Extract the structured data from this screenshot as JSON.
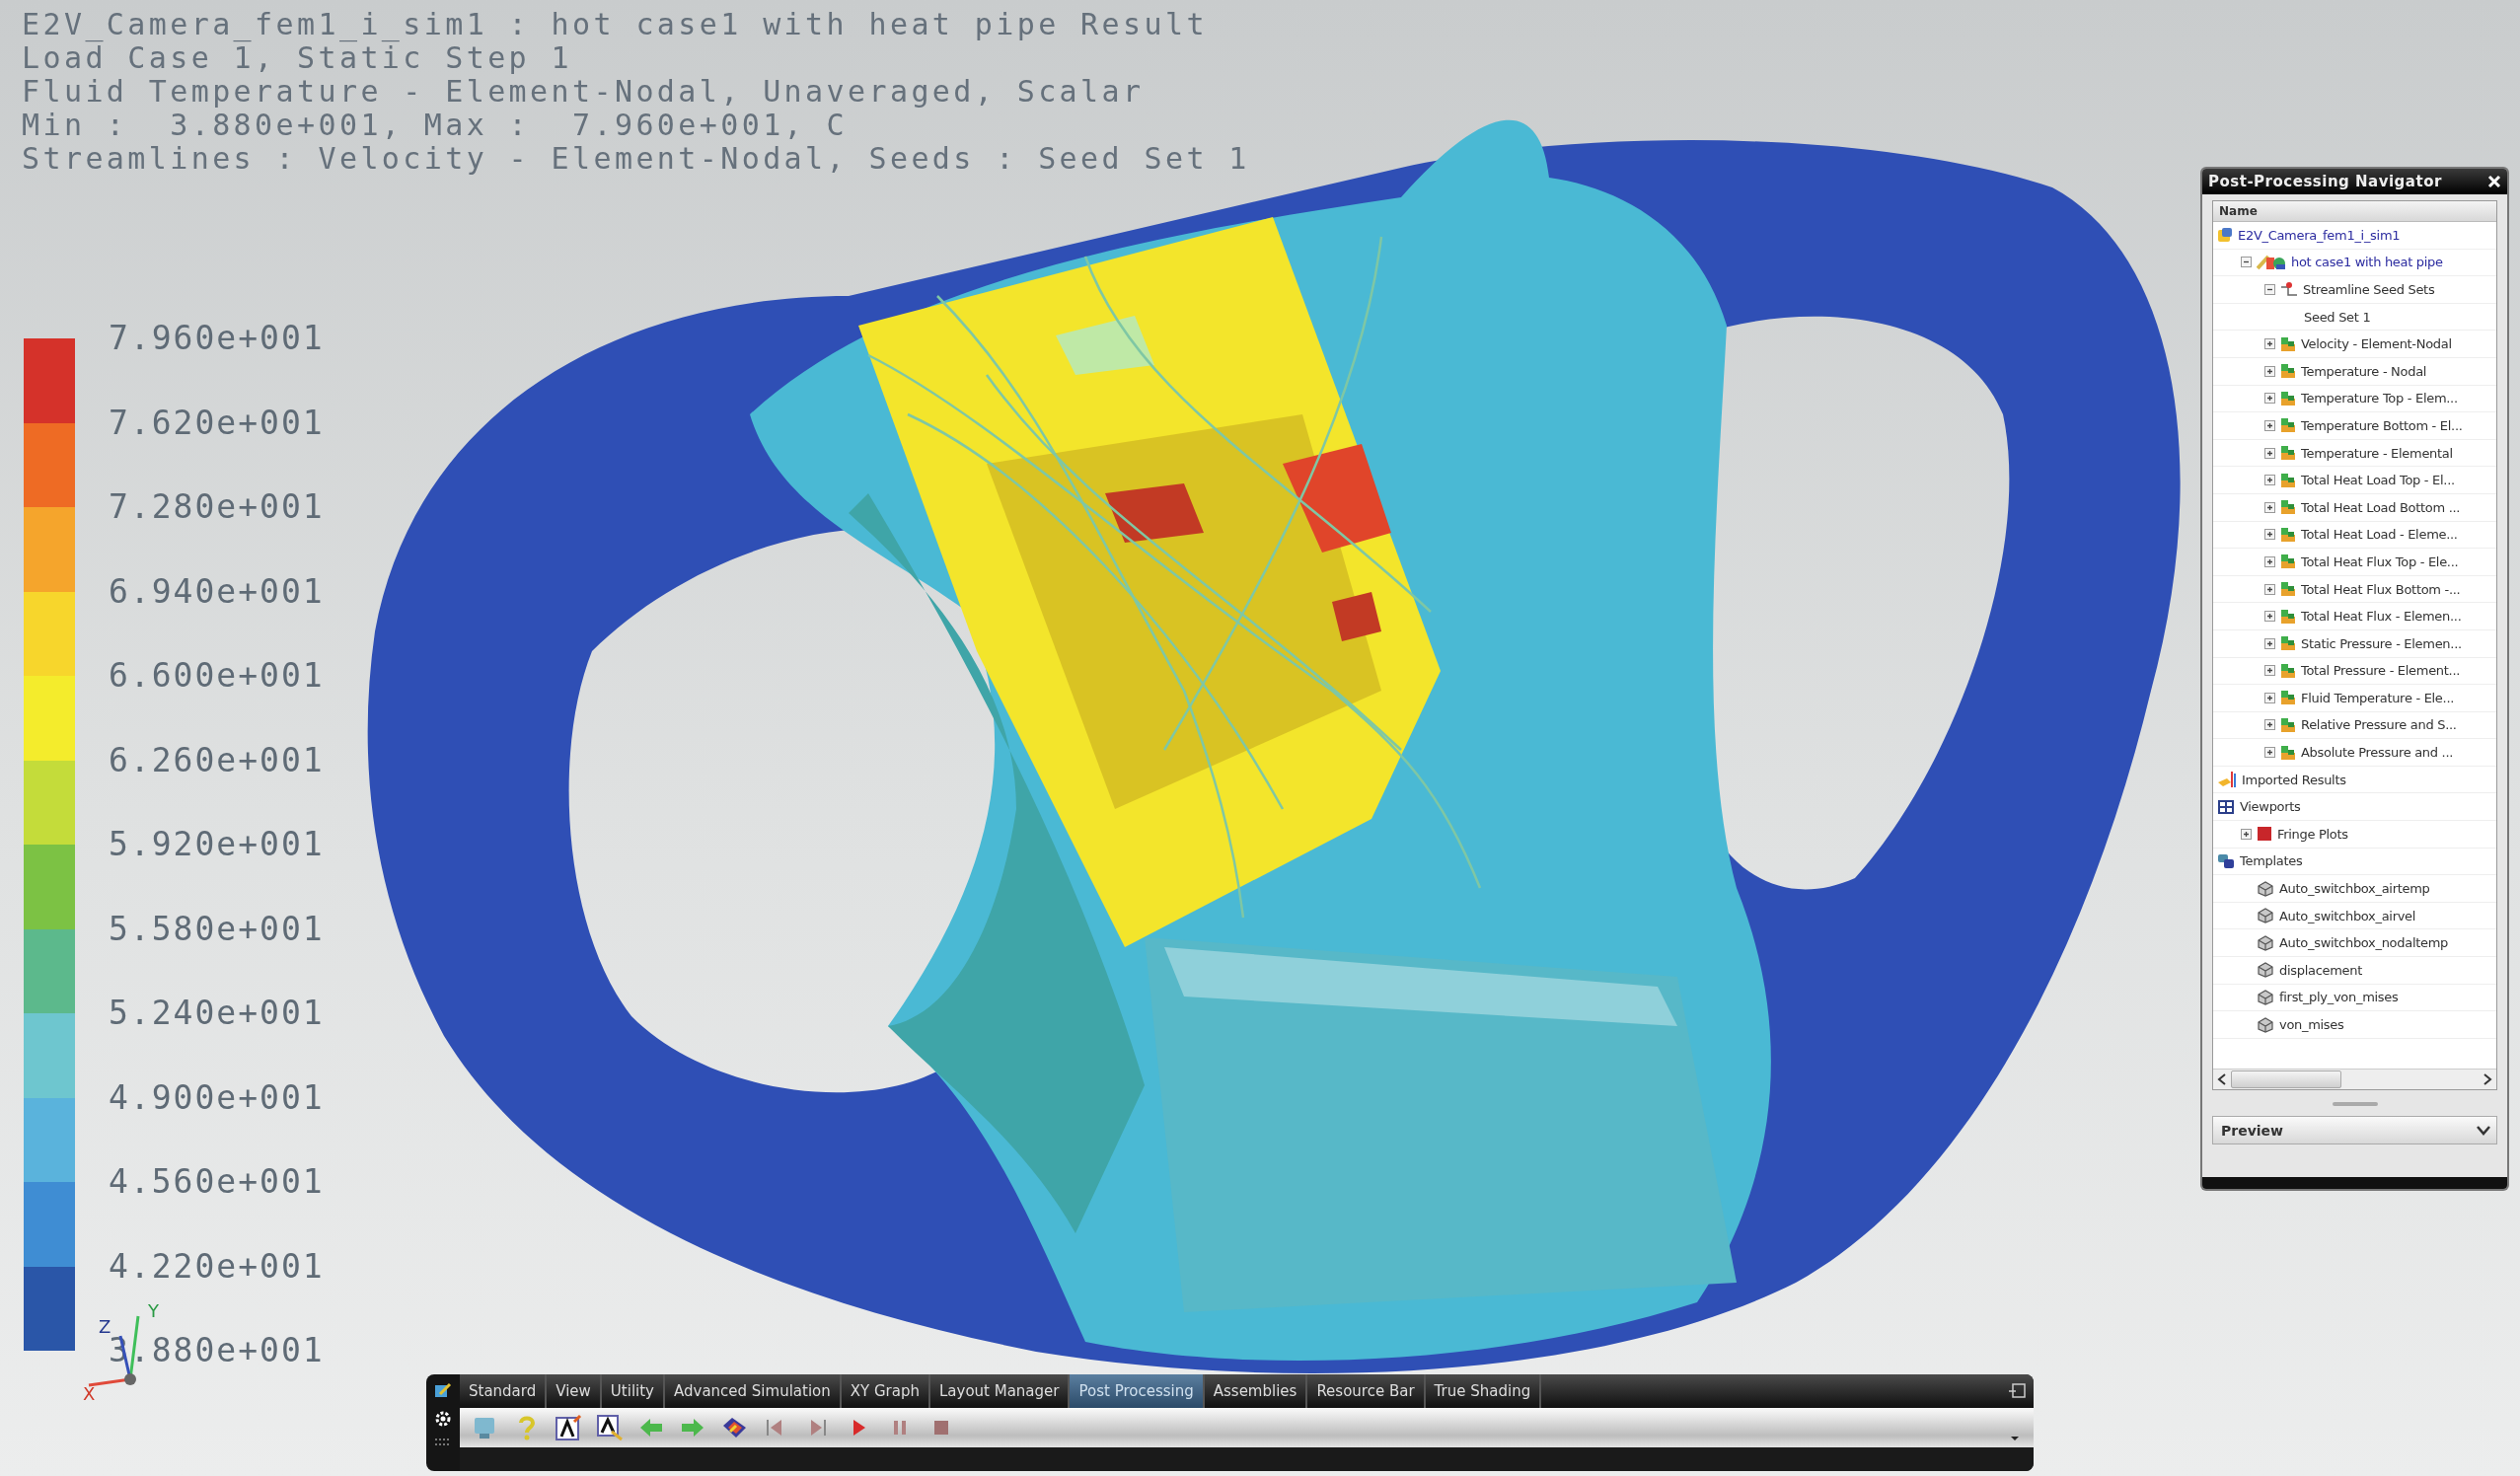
{
  "header": {
    "lines": [
      "E2V_Camera_fem1_i_sim1 : hot case1 with heat pipe Result",
      "Load Case 1, Static Step 1",
      "Fluid Temperature - Element-Nodal, Unaveraged, Scalar",
      "Min :  3.880e+001, Max :  7.960e+001, C",
      "Streamlines : Velocity - Element-Nodal, Seeds : Seed Set 1"
    ]
  },
  "legend": {
    "labels": [
      "7.960e+001",
      "7.620e+001",
      "7.280e+001",
      "6.940e+001",
      "6.600e+001",
      "6.260e+001",
      "5.920e+001",
      "5.580e+001",
      "5.240e+001",
      "4.900e+001",
      "4.560e+001",
      "4.220e+001",
      "3.880e+001"
    ]
  },
  "triad": {
    "x": "X",
    "y": "Y",
    "z": "Z"
  },
  "navigator": {
    "title": "Post-Processing Navigator",
    "column": "Name",
    "footer": "Preview",
    "tree": [
      {
        "label": "E2V_Camera_fem1_i_sim1",
        "kind": "sim",
        "children": [
          {
            "label": "hot case1 with heat pipe",
            "kind": "solution",
            "expanded": true,
            "children": [
              {
                "label": "Streamline Seed Sets",
                "kind": "seedsets",
                "expanded": true,
                "children": [
                  {
                    "label": "Seed Set 1"
                  }
                ]
              },
              {
                "label": "Velocity - Element-Nodal",
                "kind": "result",
                "expanded": false
              },
              {
                "label": "Temperature - Nodal",
                "kind": "result",
                "expanded": false
              },
              {
                "label": "Temperature Top - Elem...",
                "kind": "result",
                "expanded": false
              },
              {
                "label": "Temperature Bottom - El...",
                "kind": "result",
                "expanded": false
              },
              {
                "label": "Temperature - Elemental",
                "kind": "result",
                "expanded": false
              },
              {
                "label": "Total Heat Load Top - El...",
                "kind": "result",
                "expanded": false
              },
              {
                "label": "Total Heat Load Bottom ...",
                "kind": "result",
                "expanded": false
              },
              {
                "label": "Total Heat Load - Eleme...",
                "kind": "result",
                "expanded": false
              },
              {
                "label": "Total Heat Flux Top - Ele...",
                "kind": "result",
                "expanded": false
              },
              {
                "label": "Total Heat Flux Bottom -...",
                "kind": "result",
                "expanded": false
              },
              {
                "label": "Total Heat Flux - Elemen...",
                "kind": "result",
                "expanded": false
              },
              {
                "label": "Static Pressure - Elemen...",
                "kind": "result",
                "expanded": false
              },
              {
                "label": "Total Pressure - Element...",
                "kind": "result",
                "expanded": false
              },
              {
                "label": "Fluid Temperature - Ele...",
                "kind": "result",
                "expanded": false
              },
              {
                "label": "Relative Pressure and S...",
                "kind": "result",
                "expanded": false
              },
              {
                "label": "Absolute Pressure and ...",
                "kind": "result",
                "expanded": false
              }
            ]
          }
        ]
      },
      {
        "label": "Imported Results",
        "kind": "imported"
      },
      {
        "label": "Viewports",
        "kind": "viewports",
        "children": [
          {
            "label": "Fringe Plots",
            "kind": "fringe",
            "expanded": false
          }
        ]
      },
      {
        "label": "Templates",
        "kind": "templates",
        "children": [
          {
            "label": "Auto_switchbox_airtemp",
            "kind": "template"
          },
          {
            "label": "Auto_switchbox_airvel",
            "kind": "template"
          },
          {
            "label": "Auto_switchbox_nodaltemp",
            "kind": "template"
          },
          {
            "label": "displacement",
            "kind": "template"
          },
          {
            "label": "first_ply_von_mises",
            "kind": "template"
          },
          {
            "label": "von_mises",
            "kind": "template"
          }
        ]
      }
    ]
  },
  "toolbar": {
    "tabs": [
      {
        "label": "Standard",
        "selected": false
      },
      {
        "label": "View",
        "selected": false
      },
      {
        "label": "Utility",
        "selected": false
      },
      {
        "label": "Advanced Simulation",
        "selected": false
      },
      {
        "label": "XY Graph",
        "selected": false
      },
      {
        "label": "Layout Manager",
        "selected": false
      },
      {
        "label": "Post Processing",
        "selected": true
      },
      {
        "label": "Assemblies",
        "selected": false
      },
      {
        "label": "Resource Bar",
        "selected": false
      },
      {
        "label": "True Shading",
        "selected": false
      }
    ]
  }
}
